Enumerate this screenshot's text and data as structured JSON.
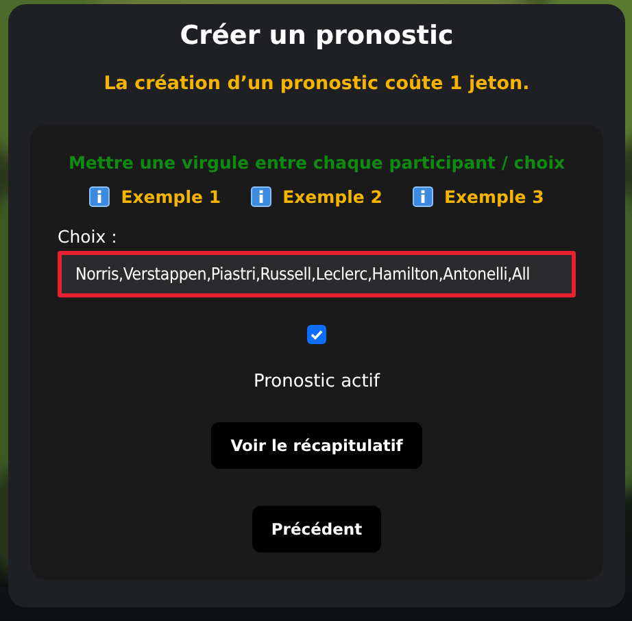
{
  "title": "Créer un pronostic",
  "cost_notice": "La création d’un pronostic coûte **1 jeton**.",
  "hint": "Mettre une virgule entre chaque participant / choix",
  "examples": [
    {
      "label": "Exemple 1"
    },
    {
      "label": "Exemple 2"
    },
    {
      "label": "Exemple 3"
    }
  ],
  "choices_field": {
    "label": "Choix :",
    "value": "Norris,Verstappen,Piastri,Russell,Leclerc,Hamilton,Antonelli,All"
  },
  "active": {
    "label": "Pronostic actif",
    "checked": true
  },
  "buttons": [
    {
      "label": "Voir le récapitulatif"
    },
    {
      "label": "Précédent"
    }
  ]
}
